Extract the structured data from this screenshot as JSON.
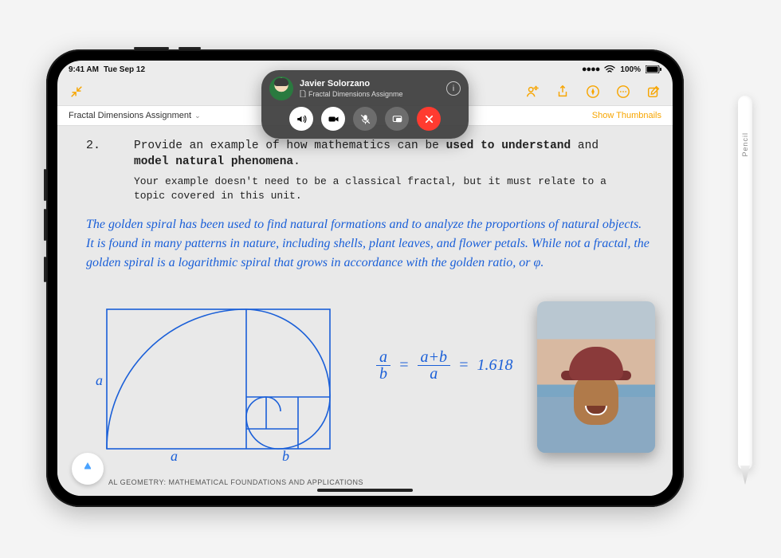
{
  "status": {
    "time": "9:41 AM",
    "date": "Tue Sep 12",
    "battery_pct": "100%"
  },
  "toolbar": {
    "doc_title": "Fractal Dimensions Assignment",
    "show_thumbnails": "Show Thumbnails"
  },
  "facetime": {
    "caller_name": "Javier Solorzano",
    "shared_doc": "Fractal Dimensions Assignme",
    "info_glyph": "i"
  },
  "document": {
    "question_number": "2.",
    "prompt_line1_a": "Provide an example of how mathematics can be ",
    "prompt_bold1": "used to understand",
    "prompt_mid": " and ",
    "prompt_bold2": "model natural phenomena",
    "prompt_end": ".",
    "prompt_sub": "Your example doesn't need to be a classical fractal, but it must relate to a topic covered in this unit.",
    "handwritten": "The golden spiral has been used to find natural formations and to analyze the proportions of natural objects. It is found in many patterns in nature, including shells, plant leaves, and flower petals. While not a fractal, the golden spiral is a logarithmic spiral that grows in accordance with the golden ratio, or φ.",
    "diagram_label_a_left": "a",
    "diagram_label_a_bottom": "a",
    "diagram_label_b_bottom": "b",
    "eq_a": "a",
    "eq_b": "b",
    "eq_ab": "a+b",
    "eq_eq": "=",
    "eq_val": "1.618",
    "footer": "AL GEOMETRY: MATHEMATICAL FOUNDATIONS AND APPLICATIONS"
  },
  "pencil": {
    "label": "Pencil"
  }
}
